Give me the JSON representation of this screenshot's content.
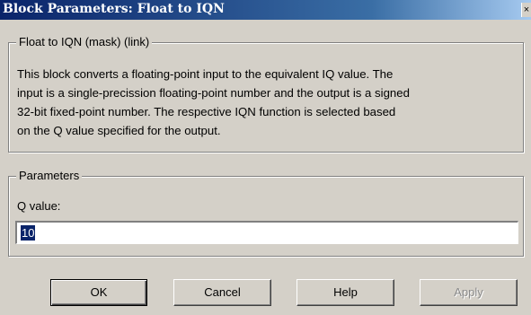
{
  "window": {
    "title": "Block Parameters: Float to IQN"
  },
  "mask_group": {
    "legend": "Float to IQN (mask) (link)",
    "description_lines": [
      "This block converts a floating-point input to the equivalent IQ value. The",
      "input is a single-precission floating-point number and the output is a signed",
      "32-bit fixed-point number. The respective IQN function is selected based",
      "on the Q value specified for the output."
    ]
  },
  "parameters_group": {
    "legend": "Parameters",
    "q_label": "Q value:",
    "q_value": "10"
  },
  "buttons": {
    "ok": "OK",
    "cancel": "Cancel",
    "help": "Help",
    "apply": "Apply"
  }
}
